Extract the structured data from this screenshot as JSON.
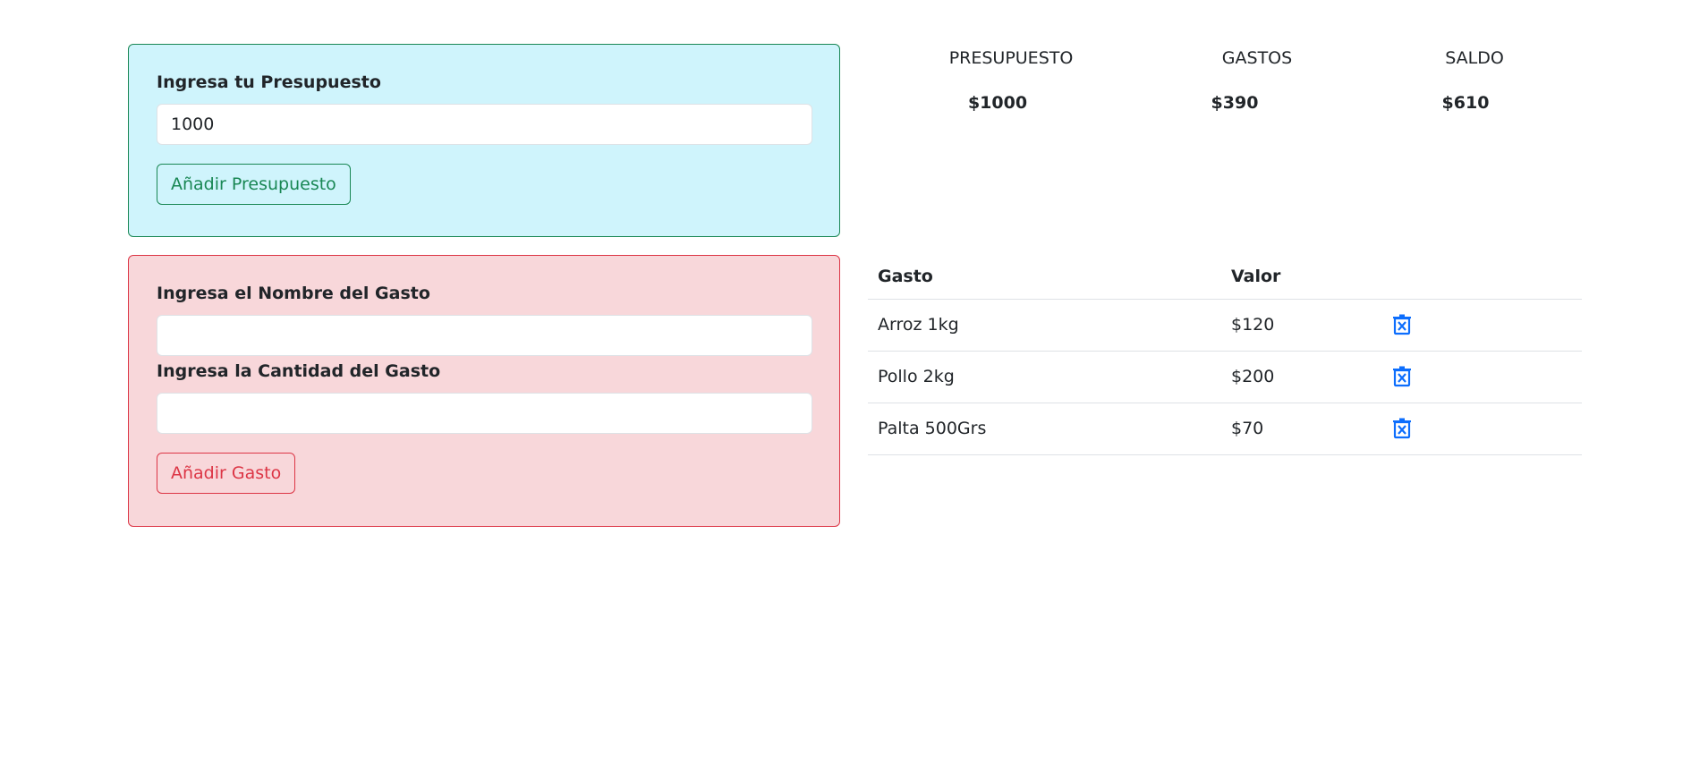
{
  "budget_form": {
    "label": "Ingresa tu Presupuesto",
    "input_value": "1000",
    "button_label": "Añadir Presupuesto"
  },
  "expense_form": {
    "name_label": "Ingresa el Nombre del Gasto",
    "name_value": "",
    "amount_label": "Ingresa la Cantidad del Gasto",
    "amount_value": "",
    "button_label": "Añadir Gasto"
  },
  "summary": {
    "budget_title": "PRESUPUESTO",
    "budget_value": "$1000",
    "expenses_title": "GASTOS",
    "expenses_value": "$390",
    "balance_title": "SALDO",
    "balance_value": "$610"
  },
  "table": {
    "headers": [
      "Gasto",
      "Valor",
      ""
    ],
    "rows": [
      {
        "name": "Arroz 1kg",
        "value": "$120",
        "action_icon": "trash-x-icon"
      },
      {
        "name": "Pollo 2kg",
        "value": "$200",
        "action_icon": "trash-x-icon"
      },
      {
        "name": "Palta 500Grs",
        "value": "$70",
        "action_icon": "trash-x-icon"
      }
    ]
  },
  "colors": {
    "budget_bg": "#cff4fc",
    "success": "#198754",
    "expense_bg": "#f8d7da",
    "danger": "#dc3545",
    "icon_blue": "#0d6efd"
  }
}
